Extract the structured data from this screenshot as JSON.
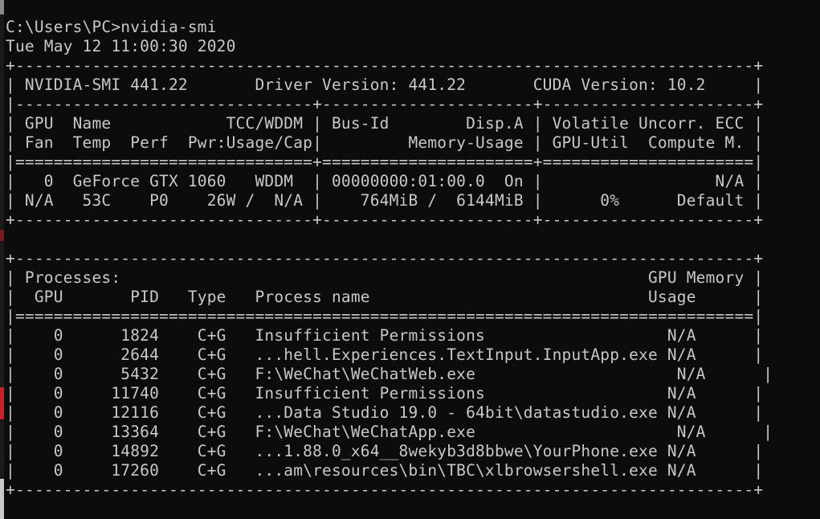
{
  "console": {
    "prompt_line": "C:\\Users\\PC>nvidia-smi",
    "timestamp": "Tue May 12 11:00:30 2020"
  },
  "gpu_table": {
    "border_top": "+-----------------------------------------------------------------------------+",
    "header": "| NVIDIA-SMI 441.22       Driver Version: 441.22       CUDA Version: 10.2     |",
    "sep1": "|-------------------------------+----------------------+----------------------+",
    "col_header_1": "| GPU  Name            TCC/WDDM | Bus-Id        Disp.A | Volatile Uncorr. ECC |",
    "col_header_2": "| Fan  Temp  Perf  Pwr:Usage/Cap|         Memory-Usage | GPU-Util  Compute M. |",
    "sep2": "|===============================+======================+======================|",
    "row_1": "|   0  GeForce GTX 1060   WDDM  | 00000000:01:00.0  On |                  N/A |",
    "row_2": "| N/A   53C    P0    26W /  N/A |    764MiB /  6144MiB |      0%      Default |",
    "border_bottom": "+-------------------------------+----------------------+----------------------+"
  },
  "processes_table": {
    "border_top": "+-----------------------------------------------------------------------------+",
    "title": "| Processes:                                                       GPU Memory |",
    "col_header": "|  GPU       PID   Type   Process name                             Usage      |",
    "sep": "|=============================================================================|",
    "rows": [
      "|    0      1824    C+G   Insufficient Permissions                   N/A      |",
      "|    0      2644    C+G   ...hell.Experiences.TextInput.InputApp.exe N/A      |",
      "|    0      5432    C+G   F:\\WeChat\\WeChatWeb.exe                     N/A      |",
      "|    0     11740    C+G   Insufficient Permissions                   N/A      |",
      "|    0     12116    C+G   ...Data Studio 19.0 - 64bit\\datastudio.exe N/A      |",
      "|    0     13364    C+G   F:\\WeChat\\WeChatApp.exe                     N/A      |",
      "|    0     14892    C+G   ...1.88.0_x64__8wekyb3d8bbwe\\YourPhone.exe N/A      |",
      "|    0     17260    C+G   ...am\\resources\\bin\\TBC\\xlbrowsershell.exe N/A      |"
    ],
    "border_bottom": "+-----------------------------------------------------------------------------+"
  }
}
